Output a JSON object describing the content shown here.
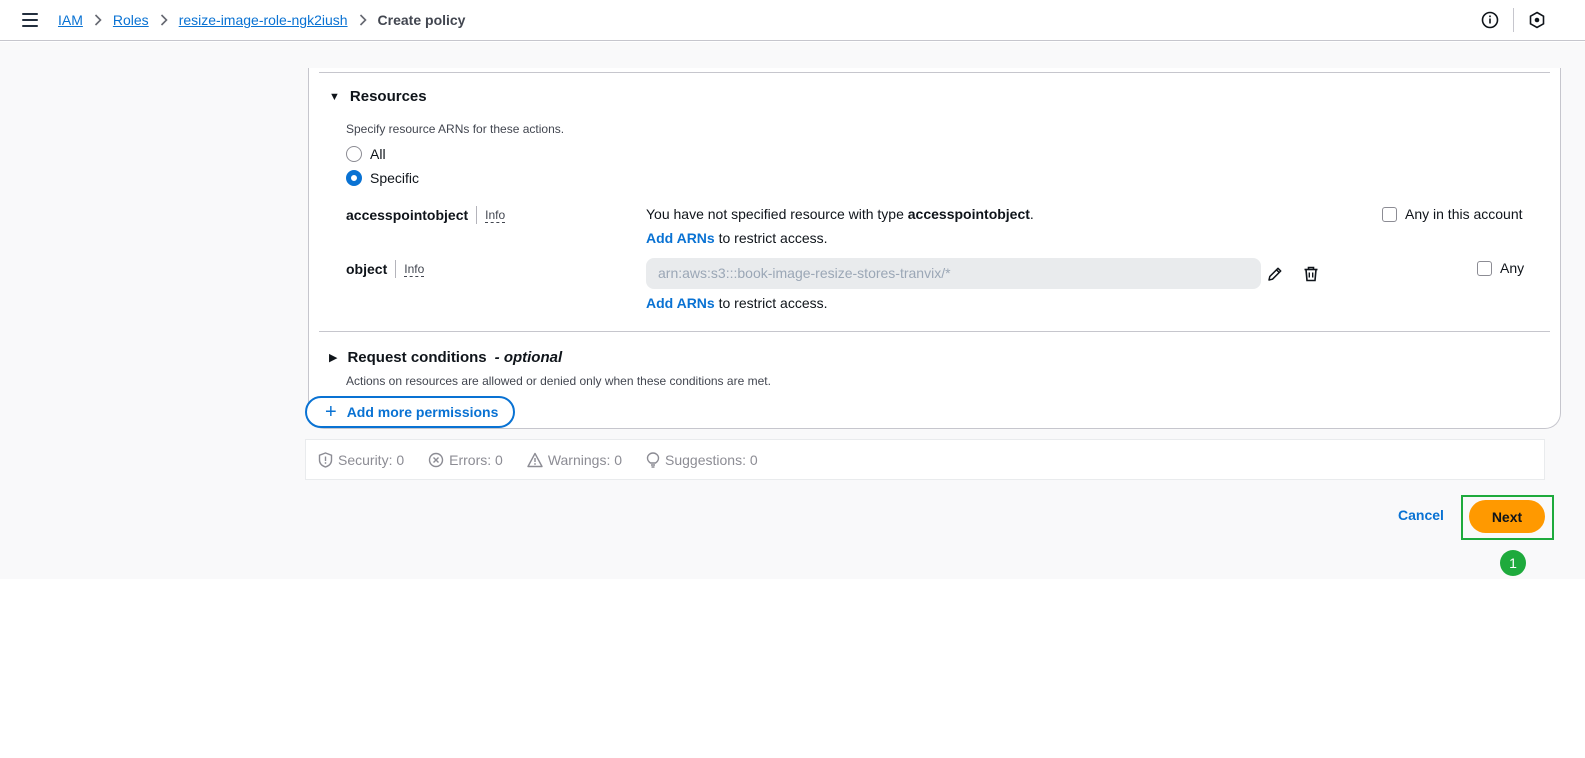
{
  "breadcrumb": {
    "items": [
      "IAM",
      "Roles",
      "resize-image-role-ngk2iush"
    ],
    "current": "Create policy"
  },
  "resources": {
    "title": "Resources",
    "description": "Specify resource ARNs for these actions.",
    "radio_all": "All",
    "radio_specific": "Specific",
    "selected": "Specific",
    "rows": [
      {
        "name": "accesspointobject",
        "info": "Info",
        "message_prefix": "You have not specified resource with type ",
        "message_type": "accesspointobject",
        "message_suffix": ".",
        "add_arns": "Add ARNs",
        "add_arns_suffix": " to restrict access.",
        "checkbox_label": "Any in this account"
      },
      {
        "name": "object",
        "info": "Info",
        "arn_value": "arn:aws:s3:::book-image-resize-stores-tranvix/*",
        "add_arns": "Add ARNs",
        "add_arns_suffix": " to restrict access.",
        "checkbox_label": "Any"
      }
    ]
  },
  "request_conditions": {
    "title": "Request conditions",
    "optional": "- optional",
    "description": "Actions on resources are allowed or denied only when these conditions are met."
  },
  "add_more_permissions": "Add more permissions",
  "status": {
    "security": "Security: 0",
    "errors": "Errors: 0",
    "warnings": "Warnings: 0",
    "suggestions": "Suggestions: 0"
  },
  "actions": {
    "cancel": "Cancel",
    "next": "Next"
  },
  "annotation_badge": "1",
  "colors": {
    "link": "#0972d3",
    "primary_button": "#ff9900",
    "highlight": "#1eaa3c"
  }
}
